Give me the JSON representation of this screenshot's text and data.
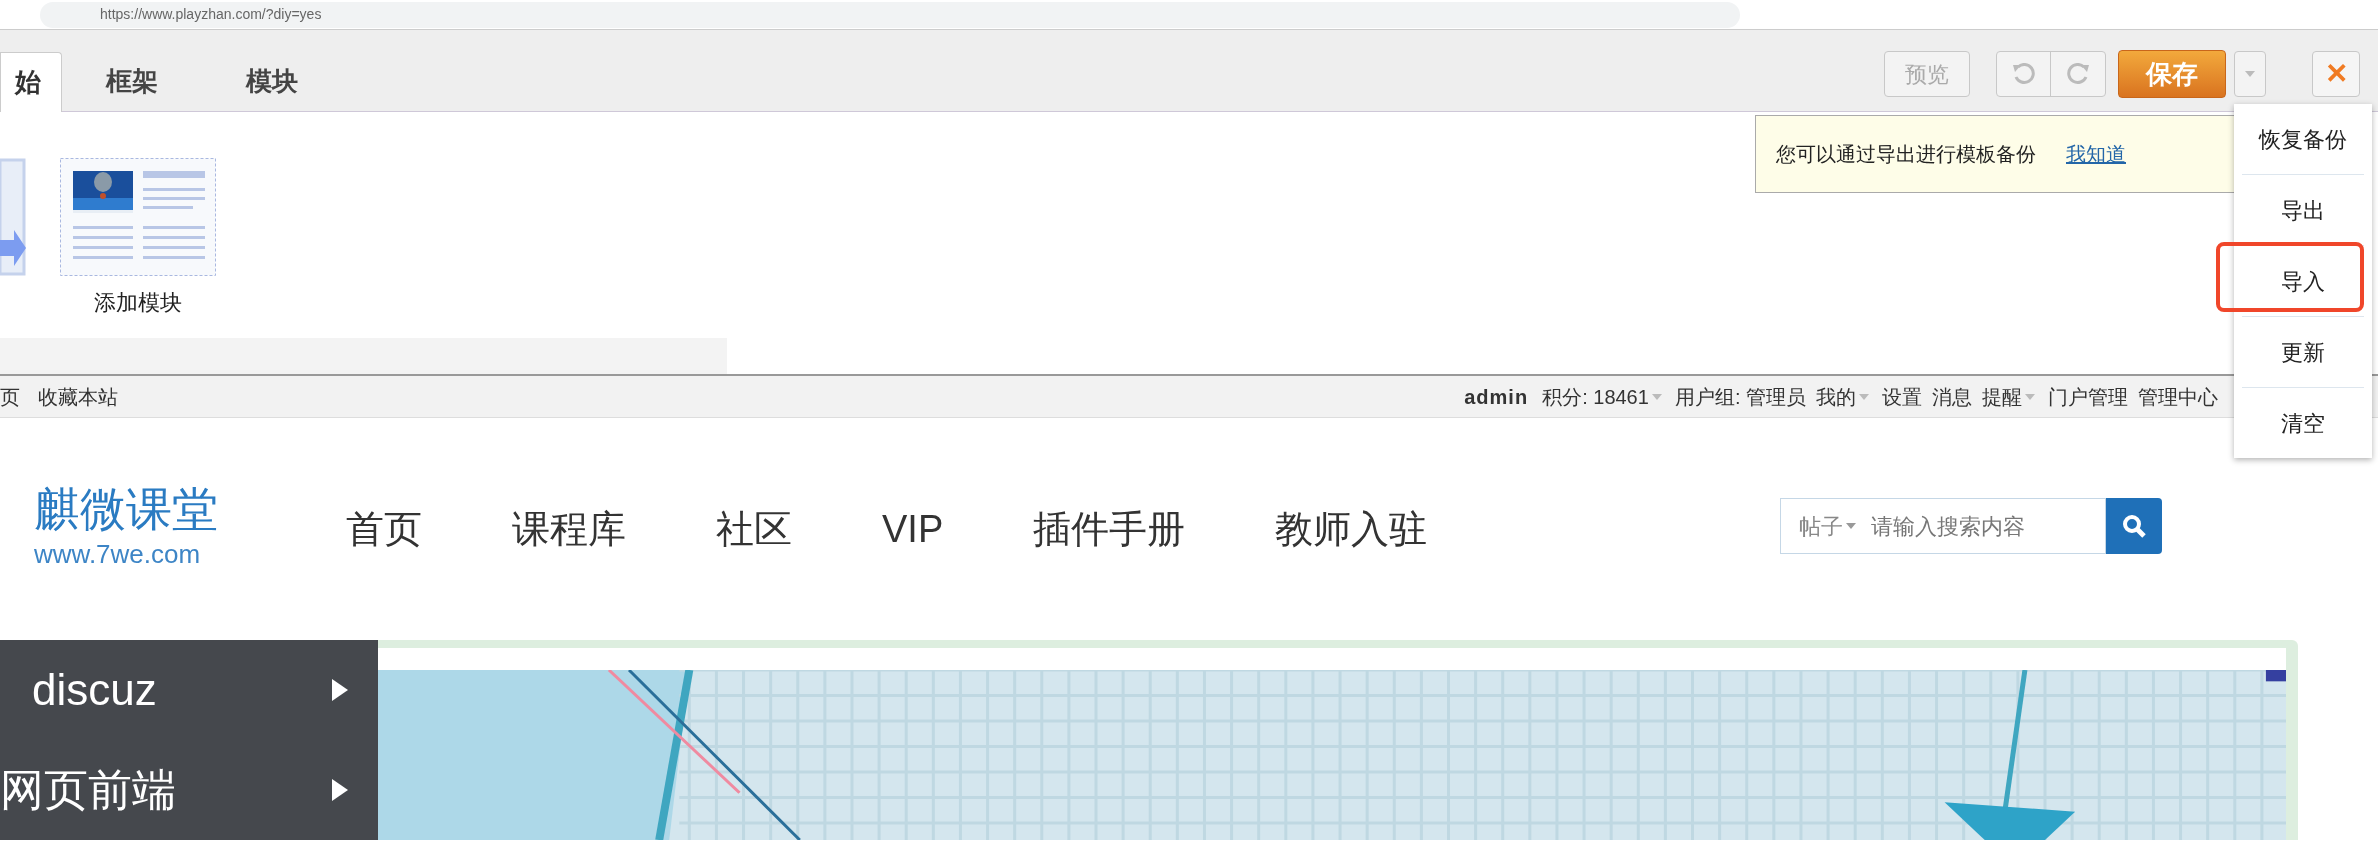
{
  "browser": {
    "url": "https://www.playzhan.com/?diy=yes"
  },
  "diy_tabs": [
    {
      "label": "始",
      "selected": true
    },
    {
      "label": "框架",
      "selected": false
    },
    {
      "label": "模块",
      "selected": false
    }
  ],
  "toolbar": {
    "preview": "预览",
    "save": "保存",
    "close": "✕"
  },
  "module": {
    "label": "添加模块"
  },
  "tip": {
    "text": "您可以通过导出进行模板备份",
    "link": "我知道"
  },
  "menu": [
    {
      "label": "恢复备份",
      "highlighted": false
    },
    {
      "label": "导出",
      "highlighted": false
    },
    {
      "label": "导入",
      "highlighted": true
    },
    {
      "label": "更新",
      "highlighted": false
    },
    {
      "label": "清空",
      "highlighted": false
    }
  ],
  "topbar": {
    "left": [
      "页",
      "收藏本站"
    ],
    "user": "admin",
    "links": [
      {
        "label": "积分: 18461",
        "dropdown": true
      },
      {
        "label": "用户组: 管理员",
        "dropdown": false
      },
      {
        "label": "我的",
        "dropdown": true
      },
      {
        "label": "设置",
        "dropdown": false
      },
      {
        "label": "消息",
        "dropdown": false
      },
      {
        "label": "提醒",
        "dropdown": true
      },
      {
        "label": "门户管理",
        "dropdown": false
      },
      {
        "label": "管理中心",
        "dropdown": false
      }
    ]
  },
  "logo": {
    "title": "麒微课堂",
    "url": "www.7we.com"
  },
  "nav": [
    "首页",
    "课程库",
    "社区",
    "VIP",
    "插件手册",
    "教师入驻"
  ],
  "search": {
    "scope": "帖子",
    "placeholder": "请输入搜索内容"
  },
  "sidebar": [
    "discuz",
    "网页前端"
  ]
}
